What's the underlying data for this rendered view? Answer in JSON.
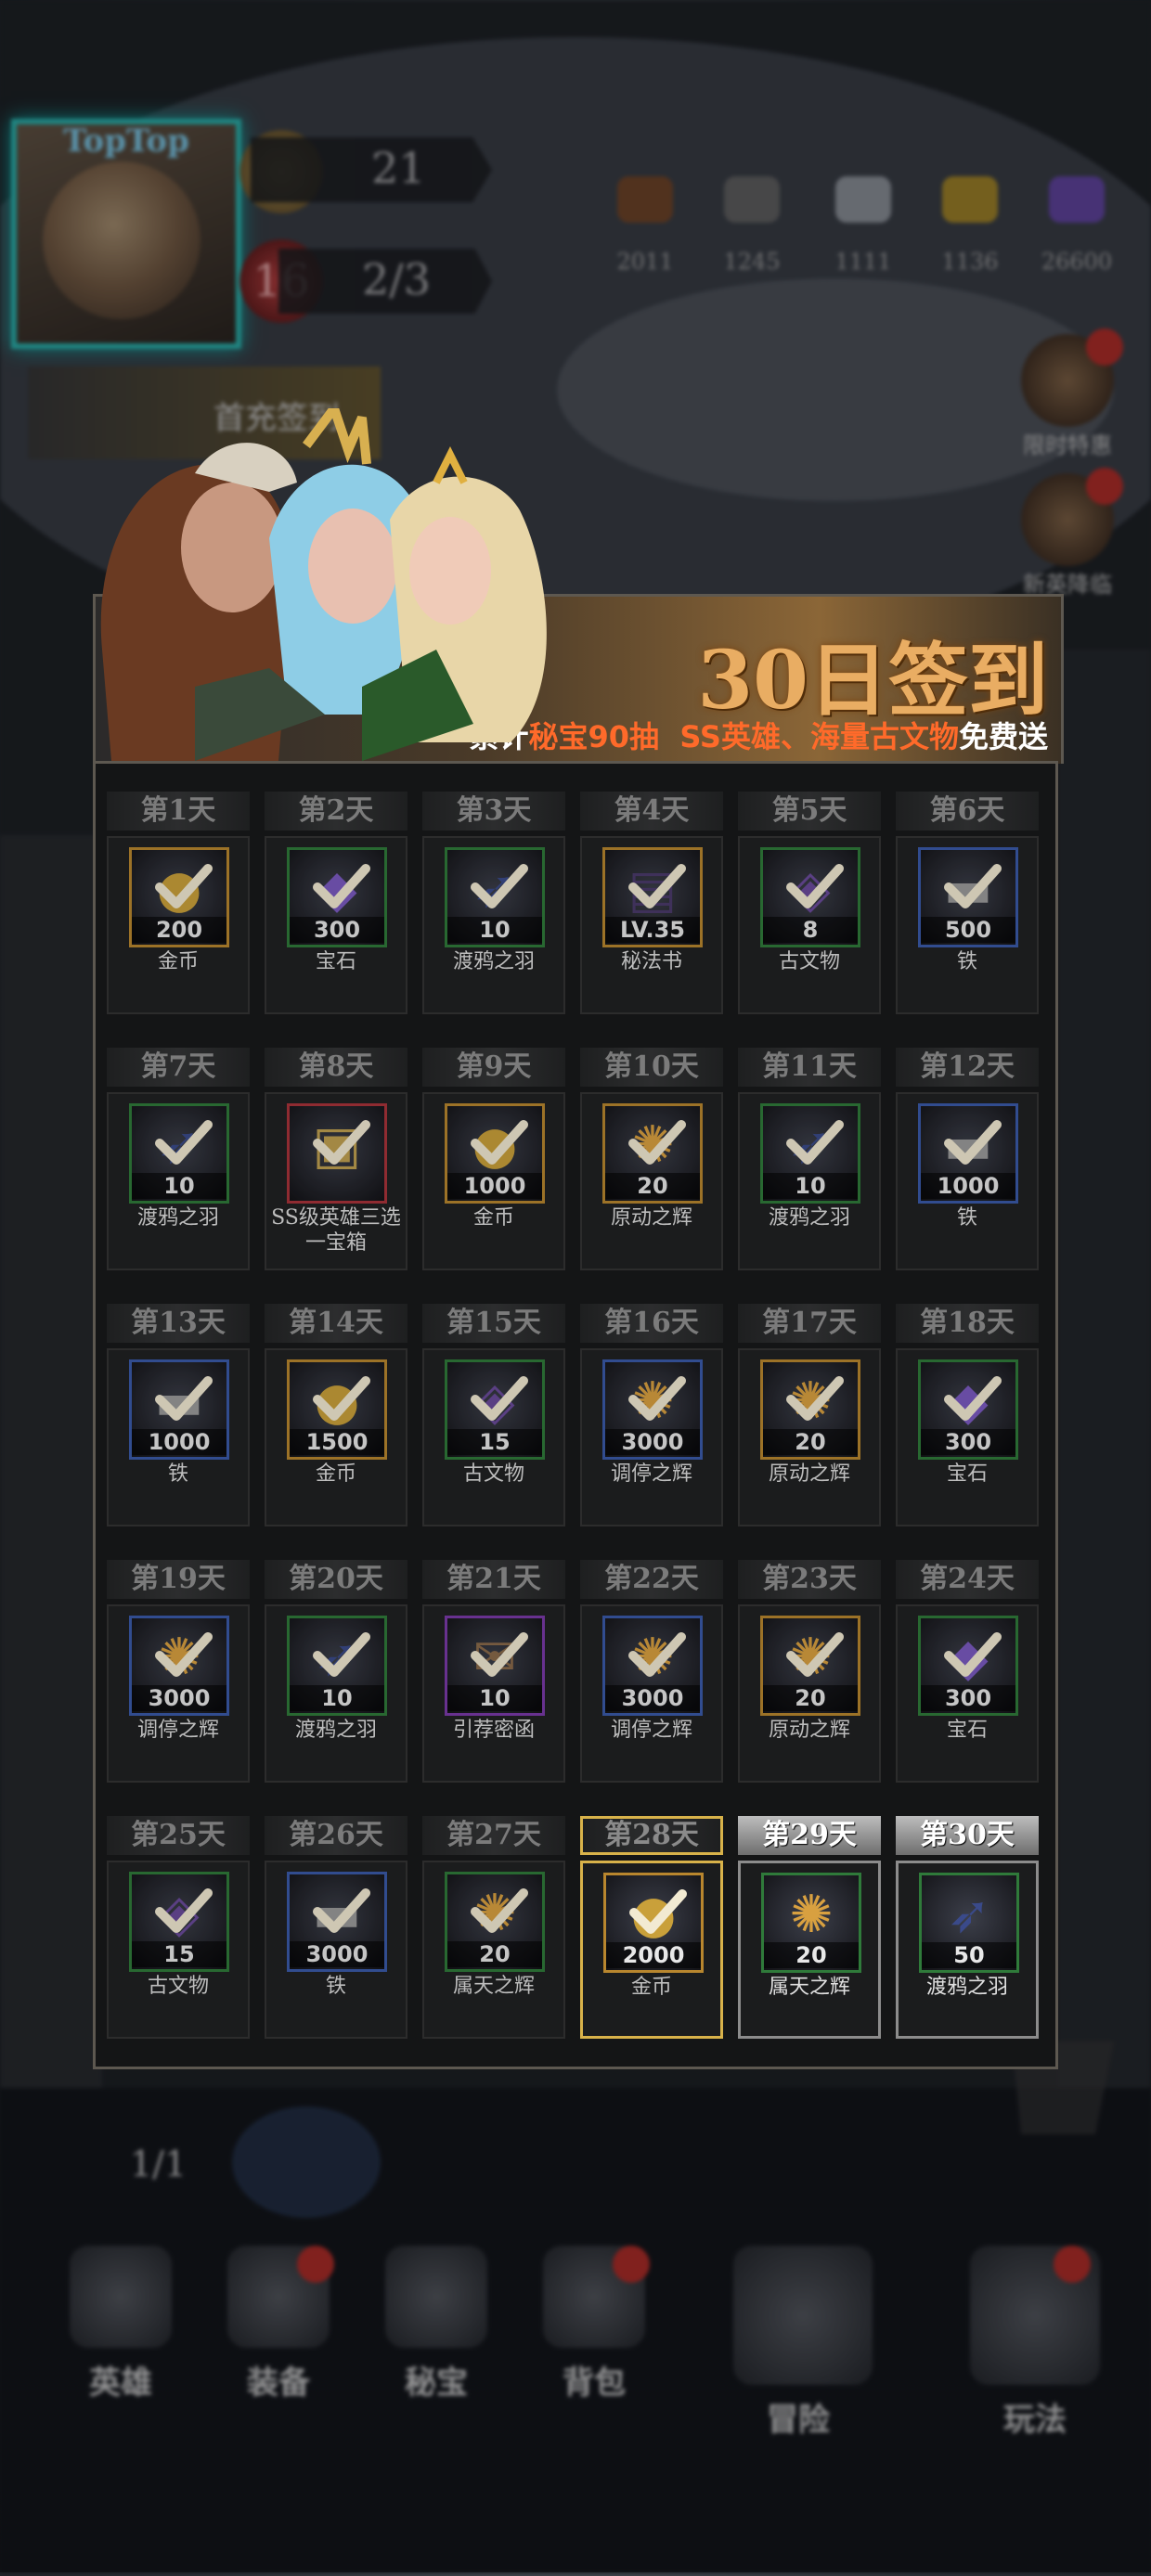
{
  "hud": {
    "player_name": "TopTop",
    "level_value": "21",
    "stage_number": "16",
    "stage_progress": "2/3",
    "resources": [
      {
        "icon": "leather-icon",
        "value": "2011",
        "color": "#7a4a2a"
      },
      {
        "icon": "ore-icon",
        "value": "1245",
        "color": "#6a6a6a"
      },
      {
        "icon": "crystal-icon",
        "value": "1111",
        "color": "#9aa0a8"
      },
      {
        "icon": "gold-ore-icon",
        "value": "1136",
        "color": "#b0902a"
      },
      {
        "icon": "amethyst-icon",
        "value": "26600",
        "color": "#6a4ab0"
      }
    ],
    "first_recharge_label": "首充签到",
    "side_buttons": [
      {
        "label": "限时特惠",
        "icon": "gift-icon"
      },
      {
        "label": "新英降临",
        "icon": "hero-icon"
      }
    ],
    "map_counter": "1/1"
  },
  "popup": {
    "title": "30日签到",
    "subtitle_prefix": "累计",
    "subtitle_hl1": "秘宝90抽",
    "subtitle_sep": "  ",
    "subtitle_hl2": "SS英雄、海量古文物",
    "subtitle_suffix": "免费送",
    "colors": {
      "title": "#e9ad63",
      "highlight": "#ff6a2a",
      "today_border": "#d8b24a"
    }
  },
  "days": [
    {
      "label": "第1天",
      "qty": "200",
      "name": "金币",
      "icon": "coin-icon",
      "rarity": "gold",
      "state": "claimed"
    },
    {
      "label": "第2天",
      "qty": "300",
      "name": "宝石",
      "icon": "gem-icon",
      "rarity": "green",
      "state": "claimed"
    },
    {
      "label": "第3天",
      "qty": "10",
      "name": "渡鸦之羽",
      "icon": "feather-icon",
      "rarity": "green",
      "state": "claimed"
    },
    {
      "label": "第4天",
      "qty": "LV.35",
      "name": "秘法书",
      "icon": "book-icon",
      "rarity": "gold",
      "state": "claimed"
    },
    {
      "label": "第5天",
      "qty": "8",
      "name": "古文物",
      "icon": "relic-icon",
      "rarity": "green",
      "state": "claimed"
    },
    {
      "label": "第6天",
      "qty": "500",
      "name": "铁",
      "icon": "iron-icon",
      "rarity": "blue",
      "state": "claimed"
    },
    {
      "label": "第7天",
      "qty": "10",
      "name": "渡鸦之羽",
      "icon": "feather-icon",
      "rarity": "green",
      "state": "claimed"
    },
    {
      "label": "第8天",
      "qty": "",
      "name": "SS级英雄三选一宝箱",
      "icon": "chest-icon",
      "rarity": "red",
      "state": "claimed"
    },
    {
      "label": "第9天",
      "qty": "1000",
      "name": "金币",
      "icon": "coin-icon",
      "rarity": "gold",
      "state": "claimed"
    },
    {
      "label": "第10天",
      "qty": "20",
      "name": "原动之辉",
      "icon": "radiance-icon",
      "rarity": "gold",
      "state": "claimed"
    },
    {
      "label": "第11天",
      "qty": "10",
      "name": "渡鸦之羽",
      "icon": "feather-icon",
      "rarity": "green",
      "state": "claimed"
    },
    {
      "label": "第12天",
      "qty": "1000",
      "name": "铁",
      "icon": "iron-icon",
      "rarity": "blue",
      "state": "claimed"
    },
    {
      "label": "第13天",
      "qty": "1000",
      "name": "铁",
      "icon": "iron-icon",
      "rarity": "blue",
      "state": "claimed"
    },
    {
      "label": "第14天",
      "qty": "1500",
      "name": "金币",
      "icon": "coin-icon",
      "rarity": "gold",
      "state": "claimed"
    },
    {
      "label": "第15天",
      "qty": "15",
      "name": "古文物",
      "icon": "relic-icon",
      "rarity": "green",
      "state": "claimed"
    },
    {
      "label": "第16天",
      "qty": "3000",
      "name": "调停之辉",
      "icon": "radiance-icon",
      "rarity": "blue",
      "state": "claimed"
    },
    {
      "label": "第17天",
      "qty": "20",
      "name": "原动之辉",
      "icon": "radiance-icon",
      "rarity": "gold",
      "state": "claimed"
    },
    {
      "label": "第18天",
      "qty": "300",
      "name": "宝石",
      "icon": "gem-icon",
      "rarity": "green",
      "state": "claimed"
    },
    {
      "label": "第19天",
      "qty": "3000",
      "name": "调停之辉",
      "icon": "radiance-icon",
      "rarity": "blue",
      "state": "claimed"
    },
    {
      "label": "第20天",
      "qty": "10",
      "name": "渡鸦之羽",
      "icon": "feather-icon",
      "rarity": "green",
      "state": "claimed"
    },
    {
      "label": "第21天",
      "qty": "10",
      "name": "引荐密函",
      "icon": "letter-icon",
      "rarity": "purple",
      "state": "claimed"
    },
    {
      "label": "第22天",
      "qty": "3000",
      "name": "调停之辉",
      "icon": "radiance-icon",
      "rarity": "blue",
      "state": "claimed"
    },
    {
      "label": "第23天",
      "qty": "20",
      "name": "原动之辉",
      "icon": "radiance-icon",
      "rarity": "gold",
      "state": "claimed"
    },
    {
      "label": "第24天",
      "qty": "300",
      "name": "宝石",
      "icon": "gem-icon",
      "rarity": "green",
      "state": "claimed"
    },
    {
      "label": "第25天",
      "qty": "15",
      "name": "古文物",
      "icon": "relic-icon",
      "rarity": "green",
      "state": "claimed"
    },
    {
      "label": "第26天",
      "qty": "3000",
      "name": "铁",
      "icon": "iron-icon",
      "rarity": "blue",
      "state": "claimed"
    },
    {
      "label": "第27天",
      "qty": "20",
      "name": "属天之辉",
      "icon": "radiance-icon",
      "rarity": "green",
      "state": "claimed"
    },
    {
      "label": "第28天",
      "qty": "2000",
      "name": "金币",
      "icon": "coin-icon",
      "rarity": "gold",
      "state": "today"
    },
    {
      "label": "第29天",
      "qty": "20",
      "name": "属天之辉",
      "icon": "radiance-icon",
      "rarity": "green",
      "state": "future"
    },
    {
      "label": "第30天",
      "qty": "50",
      "name": "渡鸦之羽",
      "icon": "feather-icon",
      "rarity": "green",
      "state": "future"
    }
  ],
  "rarity_colors": {
    "gold": "#b8862e",
    "green": "#2f7a3a",
    "blue": "#3a5aa8",
    "red": "#a8323a",
    "purple": "#7a3aa8"
  },
  "nav": [
    {
      "label": "英雄",
      "icon": "hero-nav-icon",
      "badge": false
    },
    {
      "label": "装备",
      "icon": "sword-nav-icon",
      "badge": true
    },
    {
      "label": "秘宝",
      "icon": "chalice-nav-icon",
      "badge": false
    },
    {
      "label": "背包",
      "icon": "bag-nav-icon",
      "badge": true
    },
    {
      "label": "冒险",
      "icon": "crossed-swords-nav-icon",
      "badge": false
    },
    {
      "label": "玩法",
      "icon": "gate-nav-icon",
      "badge": true
    }
  ]
}
